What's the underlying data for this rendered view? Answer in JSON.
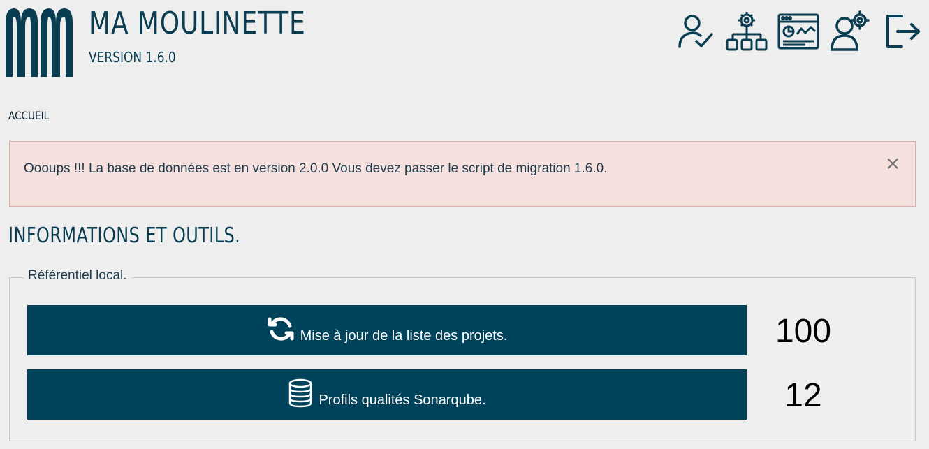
{
  "header": {
    "title": "MA MOULINETTE",
    "version": "VERSION 1.6.0",
    "accent_color": "#0b3d52"
  },
  "toolbar": {
    "icons": [
      "user-check-icon",
      "org-settings-icon",
      "dashboard-icon",
      "user-settings-icon",
      "logout-icon"
    ]
  },
  "breadcrumb": "ACCUEIL",
  "alert": {
    "message": "Oooups !!! La base de données est en version 2.0.0 Vous devez passer le script de migration 1.6.0.",
    "close_symbol": "×",
    "background": "#f6e1df"
  },
  "section": {
    "title": "INFORMATIONS ET OUTILS."
  },
  "local_repo": {
    "legend": "Référentiel local.",
    "actions": [
      {
        "label": "Mise à jour de la liste des projets.",
        "icon": "sync-icon",
        "count": "100"
      },
      {
        "label": "Profils qualités Sonarqube.",
        "icon": "database-icon",
        "count": "12"
      }
    ],
    "button_color": "#00435a"
  }
}
